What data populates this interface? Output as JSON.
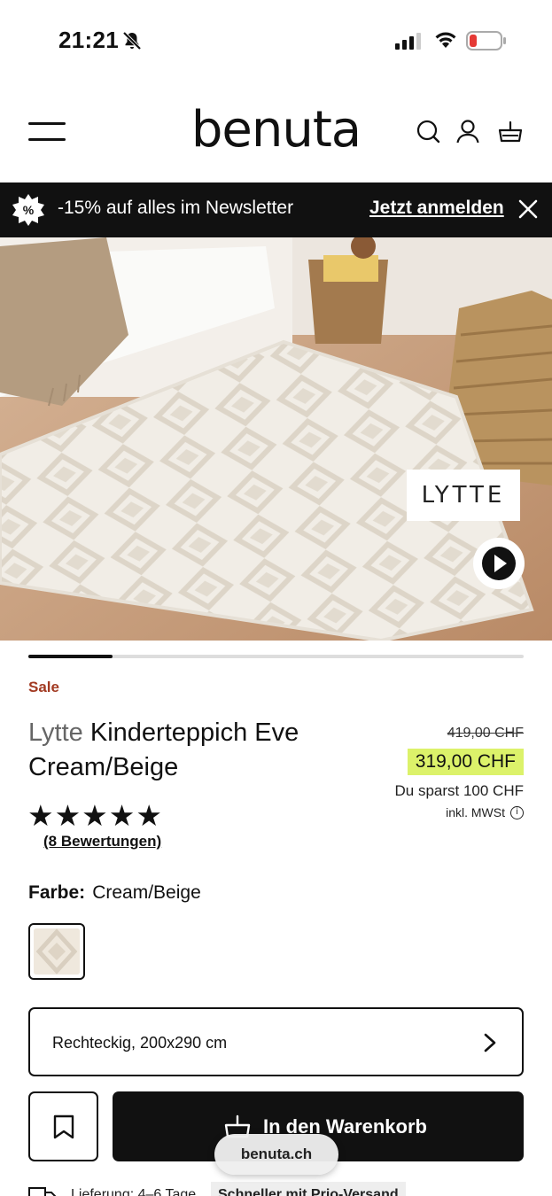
{
  "status_bar": {
    "time": "21:21"
  },
  "header": {
    "logo": "benuta"
  },
  "promo": {
    "badge_symbol": "%",
    "text": "-15% auf alles im Newsletter",
    "link": "Jetzt anmelden"
  },
  "hero": {
    "brand_badge": "LYTTE",
    "gallery_progress": 0.17
  },
  "product": {
    "sale_label": "Sale",
    "brand": "Lytte",
    "name": "Kinderteppich Eve Cream/Beige",
    "old_price": "419,00 CHF",
    "price": "319,00 CHF",
    "savings": "Du sparst 100 CHF",
    "tax_note": "inkl. MWSt",
    "rating": 4.5,
    "stars": "★★★★★",
    "reviews": "(8 Bewertungen)",
    "color_label": "Farbe:",
    "color_value": "Cream/Beige",
    "size_value": "Rechteckig, 200x290 cm",
    "add_to_cart": "In den Warenkorb"
  },
  "browser": {
    "url": "benuta.ch"
  },
  "delivery": {
    "text": "Lieferung: 4–6 Tage",
    "express": "Schneller mit Prio-Versand"
  },
  "colors": {
    "promo_bg": "#111111",
    "price_highlight": "#dcf26a",
    "sale_red": "#a23a22",
    "battery_low": "#e53935"
  }
}
